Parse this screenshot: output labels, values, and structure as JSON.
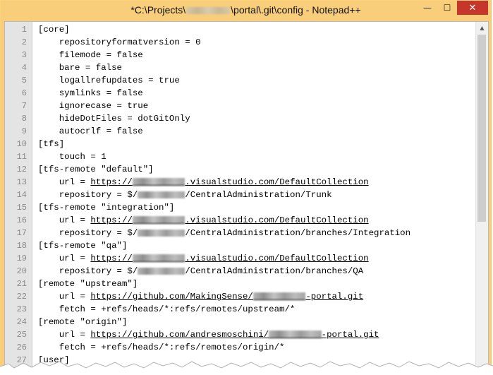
{
  "window": {
    "title_prefix": "*C:\\Projects\\",
    "title_suffix": "\\portal\\.git\\config - Notepad++",
    "minimize_glyph": "—",
    "maximize_glyph": "☐",
    "close_glyph": "✕"
  },
  "editor": {
    "lines": [
      {
        "n": "1",
        "parts": [
          {
            "t": "[core]"
          }
        ]
      },
      {
        "n": "2",
        "parts": [
          {
            "t": "    repositoryformatversion = 0"
          }
        ]
      },
      {
        "n": "3",
        "parts": [
          {
            "t": "    filemode = false"
          }
        ]
      },
      {
        "n": "4",
        "parts": [
          {
            "t": "    bare = false"
          }
        ]
      },
      {
        "n": "5",
        "parts": [
          {
            "t": "    logallrefupdates = true"
          }
        ]
      },
      {
        "n": "6",
        "parts": [
          {
            "t": "    symlinks = false"
          }
        ]
      },
      {
        "n": "7",
        "parts": [
          {
            "t": "    ignorecase = true"
          }
        ]
      },
      {
        "n": "8",
        "parts": [
          {
            "t": "    hideDotFiles = dotGitOnly"
          }
        ]
      },
      {
        "n": "9",
        "parts": [
          {
            "t": "    autocrlf = false"
          }
        ]
      },
      {
        "n": "10",
        "parts": [
          {
            "t": "[tfs]"
          }
        ]
      },
      {
        "n": "11",
        "parts": [
          {
            "t": "    touch = 1"
          }
        ]
      },
      {
        "n": "12",
        "parts": [
          {
            "t": "[tfs-remote \"default\"]"
          }
        ]
      },
      {
        "n": "13",
        "parts": [
          {
            "t": "    url = "
          },
          {
            "t": "https://",
            "u": true
          },
          {
            "r": 10,
            "u": true
          },
          {
            "t": ".visualstudio.com/DefaultCollection",
            "u": true
          }
        ]
      },
      {
        "n": "14",
        "parts": [
          {
            "t": "    repository = $/"
          },
          {
            "r": 9
          },
          {
            "t": "/CentralAdministration/Trunk"
          }
        ]
      },
      {
        "n": "15",
        "parts": [
          {
            "t": "[tfs-remote \"integration\"]"
          }
        ]
      },
      {
        "n": "16",
        "parts": [
          {
            "t": "    url = "
          },
          {
            "t": "https://",
            "u": true
          },
          {
            "r": 10,
            "u": true
          },
          {
            "t": ".visualstudio.com/DefaultCollection",
            "u": true
          }
        ]
      },
      {
        "n": "17",
        "parts": [
          {
            "t": "    repository = $/"
          },
          {
            "r": 9
          },
          {
            "t": "/CentralAdministration/branches/Integration"
          }
        ]
      },
      {
        "n": "18",
        "parts": [
          {
            "t": "[tfs-remote \"qa\"]"
          }
        ]
      },
      {
        "n": "19",
        "parts": [
          {
            "t": "    url = "
          },
          {
            "t": "https://",
            "u": true
          },
          {
            "r": 10,
            "u": true
          },
          {
            "t": ".visualstudio.com/DefaultCollection",
            "u": true
          }
        ]
      },
      {
        "n": "20",
        "parts": [
          {
            "t": "    repository = $/"
          },
          {
            "r": 9
          },
          {
            "t": "/CentralAdministration/branches/QA"
          }
        ]
      },
      {
        "n": "21",
        "parts": [
          {
            "t": "[remote \"upstream\"]"
          }
        ]
      },
      {
        "n": "22",
        "parts": [
          {
            "t": "    url = "
          },
          {
            "t": "https://github.com/MakingSense/",
            "u": true
          },
          {
            "r": 10,
            "u": true
          },
          {
            "t": "-portal.git",
            "u": true
          }
        ]
      },
      {
        "n": "23",
        "parts": [
          {
            "t": "    fetch = +refs/heads/*:refs/remotes/upstream/*"
          }
        ]
      },
      {
        "n": "24",
        "parts": [
          {
            "t": "[remote \"origin\"]"
          }
        ]
      },
      {
        "n": "25",
        "parts": [
          {
            "t": "    url = "
          },
          {
            "t": "https://github.com/andresmoschini/",
            "u": true
          },
          {
            "r": 10,
            "u": true
          },
          {
            "t": "-portal.git",
            "u": true
          }
        ]
      },
      {
        "n": "26",
        "parts": [
          {
            "t": "    fetch = +refs/heads/*:refs/remotes/origin/*"
          }
        ]
      },
      {
        "n": "27",
        "parts": [
          {
            "t": "[user]"
          }
        ]
      }
    ]
  },
  "scrollbar": {
    "up_glyph": "▲",
    "position": 0.0
  }
}
